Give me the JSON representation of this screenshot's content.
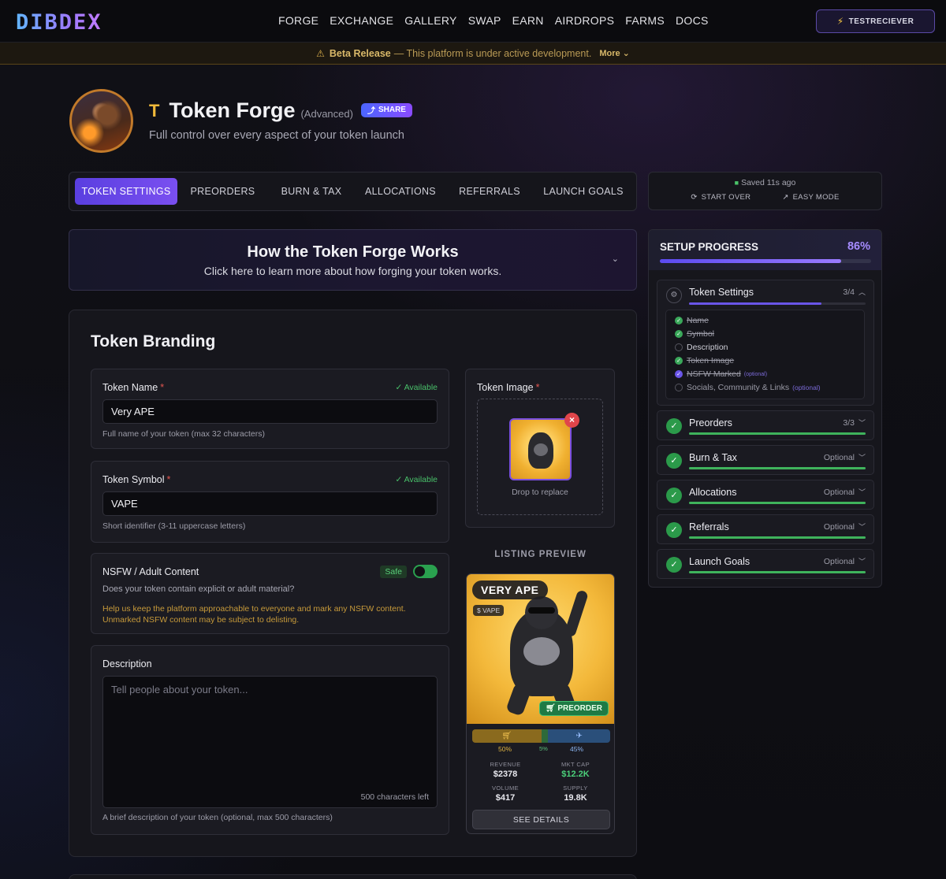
{
  "nav": {
    "logo": "DIBDEX",
    "links": [
      "FORGE",
      "EXCHANGE",
      "GALLERY",
      "SWAP",
      "EARN",
      "AIRDROPS",
      "FARMS",
      "DOCS"
    ],
    "wallet": "TESTRECIEVER"
  },
  "beta": {
    "label": "Beta Release",
    "message": "— This platform is under active development.",
    "more": "More"
  },
  "header": {
    "title": "Token Forge",
    "mode": "(Advanced)",
    "share": "SHARE",
    "subtitle": "Full control over every aspect of your token launch"
  },
  "tabs": [
    "TOKEN SETTINGS",
    "PREORDERS",
    "BURN & TAX",
    "ALLOCATIONS",
    "REFERRALS",
    "LAUNCH GOALS"
  ],
  "saved": {
    "status": "Saved 11s ago",
    "start_over": "START OVER",
    "easy_mode": "EASY MODE"
  },
  "how": {
    "title": "How the Token Forge Works",
    "subtitle": "Click here to learn more about how forging your token works."
  },
  "branding": {
    "title": "Token Branding",
    "name": {
      "label": "Token Name",
      "required": "*",
      "status": "Available",
      "value": "Very APE",
      "hint": "Full name of your token (max 32 characters)"
    },
    "symbol": {
      "label": "Token Symbol",
      "required": "*",
      "status": "Available",
      "value": "VAPE",
      "hint": "Short identifier (3-11 uppercase letters)"
    },
    "nsfw": {
      "label": "NSFW / Adult Content",
      "badge": "Safe",
      "question": "Does your token contain explicit or adult material?",
      "warning": "Help us keep the platform approachable to everyone and mark any NSFW content. Unmarked NSFW content may be subject to delisting."
    },
    "description": {
      "label": "Description",
      "placeholder": "Tell people about your token...",
      "chars_left": "500 characters left",
      "hint": "A brief description of your token (optional, max 500 characters)"
    },
    "image": {
      "label": "Token Image",
      "required": "*",
      "drop_text": "Drop to replace"
    }
  },
  "listing_preview": {
    "label": "LISTING PREVIEW",
    "name": "VERY APE",
    "symbol": "$ VAPE",
    "badge": "PREORDER",
    "split": [
      {
        "label": "50%",
        "value": 50,
        "color": "#8a6a1e"
      },
      {
        "label": "5%",
        "value": 5,
        "color": "#2e6a3a"
      },
      {
        "label": "45%",
        "value": 45,
        "color": "#2a4f7a"
      }
    ],
    "stats": {
      "revenue_label": "REVENUE",
      "revenue": "$2378",
      "mktcap_label": "MKT CAP",
      "mktcap": "$12.2K",
      "volume_label": "VOLUME",
      "volume": "$417",
      "supply_label": "SUPPLY",
      "supply": "19.8K"
    },
    "details": "SEE DETAILS"
  },
  "progress": {
    "title": "SETUP PROGRESS",
    "percent_label": "86%",
    "percent": 86,
    "sections": [
      {
        "name": "Token Settings",
        "right": "3/4",
        "fill": 75
      },
      {
        "name": "Preorders",
        "right": "3/3",
        "fill": 100
      },
      {
        "name": "Burn & Tax",
        "right": "Optional",
        "fill": 100
      },
      {
        "name": "Allocations",
        "right": "Optional",
        "fill": 100
      },
      {
        "name": "Referrals",
        "right": "Optional",
        "fill": 100
      },
      {
        "name": "Launch Goals",
        "right": "Optional",
        "fill": 100
      }
    ],
    "checklist": [
      {
        "label": "Name",
        "state": "done"
      },
      {
        "label": "Symbol",
        "state": "done"
      },
      {
        "label": "Description",
        "state": "todo"
      },
      {
        "label": "Token Image",
        "state": "done"
      },
      {
        "label": "NSFW Marked",
        "state": "marked",
        "optional": "(optional)"
      },
      {
        "label": "Socials, Community & Links",
        "state": "todo",
        "optional": "(optional)"
      }
    ]
  },
  "colors": {
    "accent": "#6a4ff0",
    "success": "#3fb35c",
    "warning": "#d8ac4a",
    "danger": "#e0454a"
  }
}
